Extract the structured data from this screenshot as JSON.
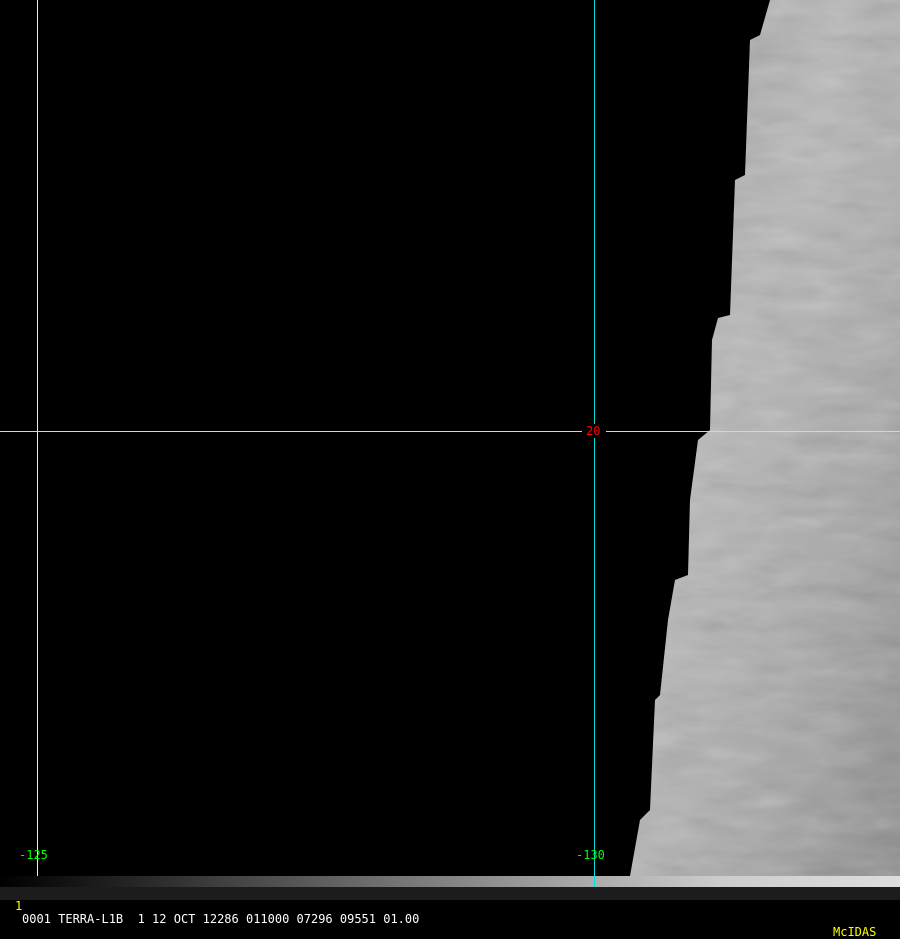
{
  "map": {
    "grid_color": "#00e0e0",
    "lon_labels": [
      "-125",
      "-130"
    ],
    "lat_labels": [
      "20"
    ],
    "lon_label_color": "#00ff00",
    "lat_label_color": "#ff0000"
  },
  "status_bar": {
    "frame_number": "1",
    "info": "0001 TERRA-L1B  1 12 OCT 12286 011000 07296 09551 01.00",
    "brand": "McIDAS",
    "frame_color": "#ffff00",
    "brand_color": "#ffff00"
  }
}
